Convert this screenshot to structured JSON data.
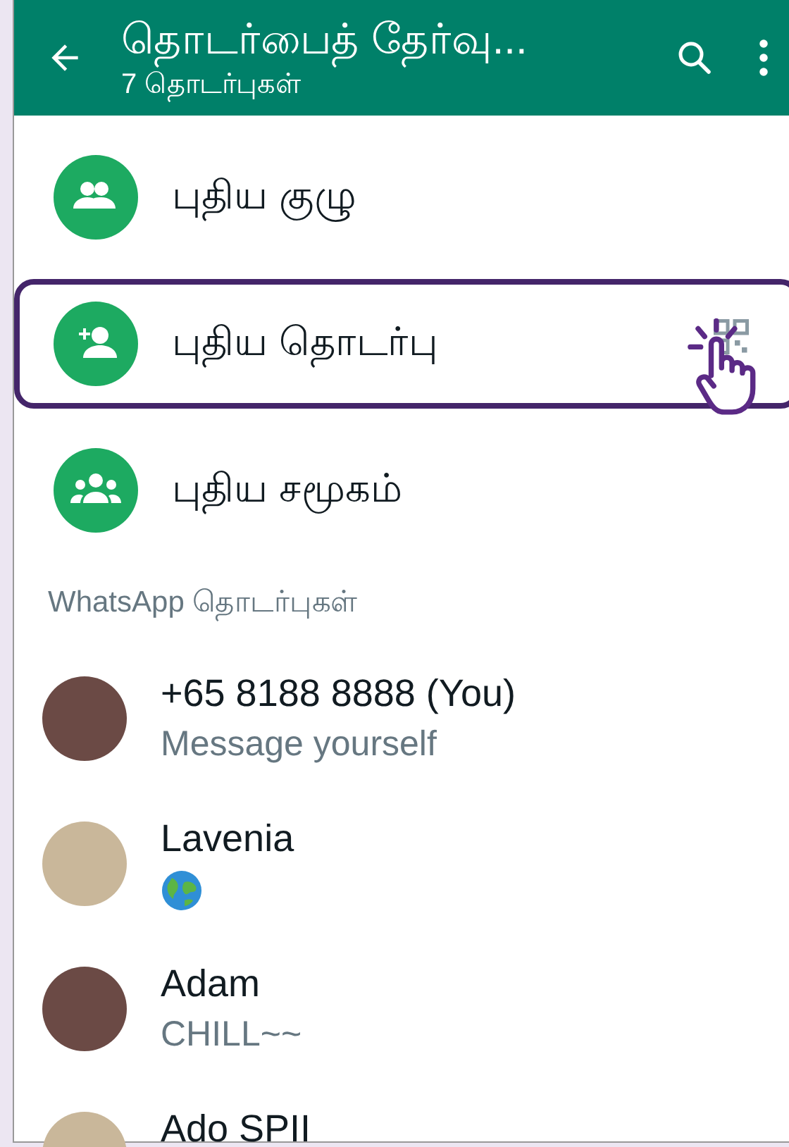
{
  "header": {
    "title": "தொடர்பைத் தேர்வு...",
    "subtitle": "7 தொடர்புகள்"
  },
  "actions": [
    {
      "kind": "group",
      "label": "புதிய குழு",
      "selected": false,
      "qr_button": false
    },
    {
      "kind": "contact",
      "label": "புதிய தொடர்பு",
      "selected": true,
      "qr_button": true
    },
    {
      "kind": "community",
      "label": "புதிய சமூகம்",
      "selected": false,
      "qr_button": false
    }
  ],
  "section_title": "WhatsApp தொடர்புகள்",
  "contacts": [
    {
      "name": "+65 8188 8888 (You)",
      "kind": "text",
      "status": "Message yourself"
    },
    {
      "name": "Lavenia",
      "kind": "globe"
    },
    {
      "name": "Adam",
      "kind": "text",
      "status": "CHILL~~"
    },
    {
      "name": "Ado SPII",
      "kind": "none"
    }
  ]
}
